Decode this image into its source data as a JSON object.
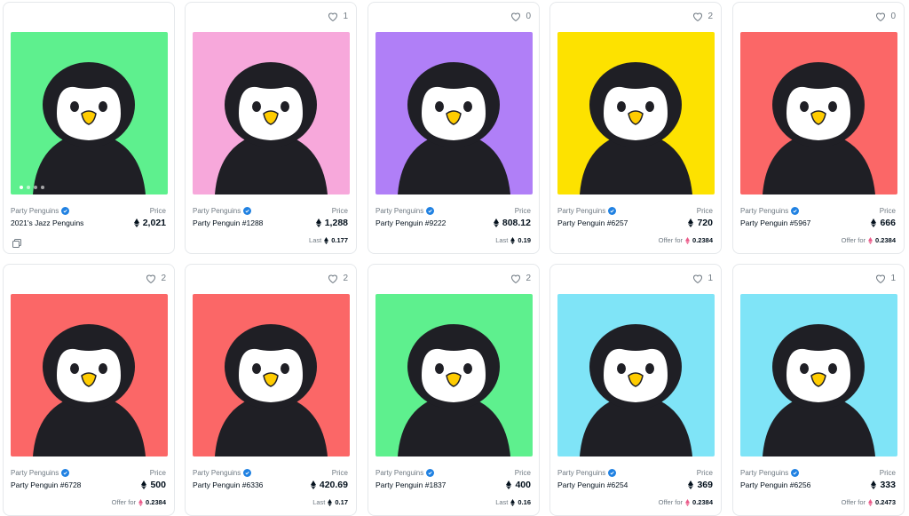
{
  "collection": "Party Penguins",
  "price_label": "Price",
  "cards": [
    {
      "name": "2021's Jazz Penguins",
      "price": "2,021",
      "likes": "",
      "foot": "",
      "foot_val": "",
      "bg": "#5ef08e",
      "bundle": true
    },
    {
      "name": "Party Penguin #1288",
      "price": "1,288",
      "likes": "1",
      "foot": "Last",
      "foot_val": "0.177",
      "bg": "#f7a8db"
    },
    {
      "name": "Party Penguin #9222",
      "price": "808.12",
      "likes": "0",
      "foot": "Last",
      "foot_val": "0.19",
      "bg": "#b07ff7"
    },
    {
      "name": "Party Penguin #6257",
      "price": "720",
      "likes": "2",
      "foot": "Offer for",
      "foot_val": "0.2384",
      "bg": "#fde200"
    },
    {
      "name": "Party Penguin #5967",
      "price": "666",
      "likes": "0",
      "foot": "Offer for",
      "foot_val": "0.2384",
      "bg": "#fb6767"
    },
    {
      "name": "Party Penguin #6728",
      "price": "500",
      "likes": "2",
      "foot": "Offer for",
      "foot_val": "0.2384",
      "bg": "#fb6767"
    },
    {
      "name": "Party Penguin #6336",
      "price": "420.69",
      "likes": "2",
      "foot": "Last",
      "foot_val": "0.17",
      "bg": "#fb6767"
    },
    {
      "name": "Party Penguin #1837",
      "price": "400",
      "likes": "2",
      "foot": "Last",
      "foot_val": "0.16",
      "bg": "#5ef08e"
    },
    {
      "name": "Party Penguin #6254",
      "price": "369",
      "likes": "1",
      "foot": "Offer for",
      "foot_val": "0.2384",
      "bg": "#7fe4f7"
    },
    {
      "name": "Party Penguin #6256",
      "price": "333",
      "likes": "1",
      "foot": "Offer for",
      "foot_val": "0.2473",
      "bg": "#7fe4f7"
    }
  ],
  "colors": {
    "accent": "#2081e2",
    "weth": "#eb5b8a",
    "text": "#04111d",
    "muted": "#707a83"
  }
}
